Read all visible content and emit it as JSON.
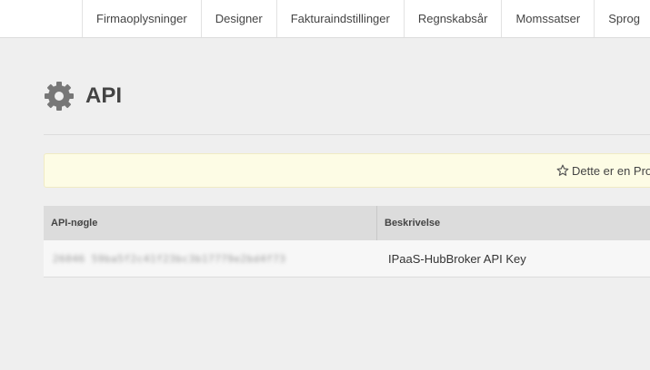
{
  "nav": {
    "tabs": [
      {
        "label": "Firmaoplysninger"
      },
      {
        "label": "Designer"
      },
      {
        "label": "Fakturaindstillinger"
      },
      {
        "label": "Regnskabsår"
      },
      {
        "label": "Momssatser"
      },
      {
        "label": "Sprog"
      }
    ]
  },
  "page": {
    "title": "API",
    "icon": "gear-icon"
  },
  "notice": {
    "icon": "star-outline-icon",
    "text": "Dette er en Pro"
  },
  "table": {
    "columns": [
      "API-nøgle",
      "Beskrivelse"
    ],
    "rows": [
      {
        "key": "26046 59ba5f2c41f23bc3b17779e2bd4f73",
        "description": "IPaaS-HubBroker API Key"
      }
    ]
  },
  "colors": {
    "background": "#efefef",
    "notice_bg": "#fdfce5",
    "header_bg": "#dcdcdc"
  }
}
